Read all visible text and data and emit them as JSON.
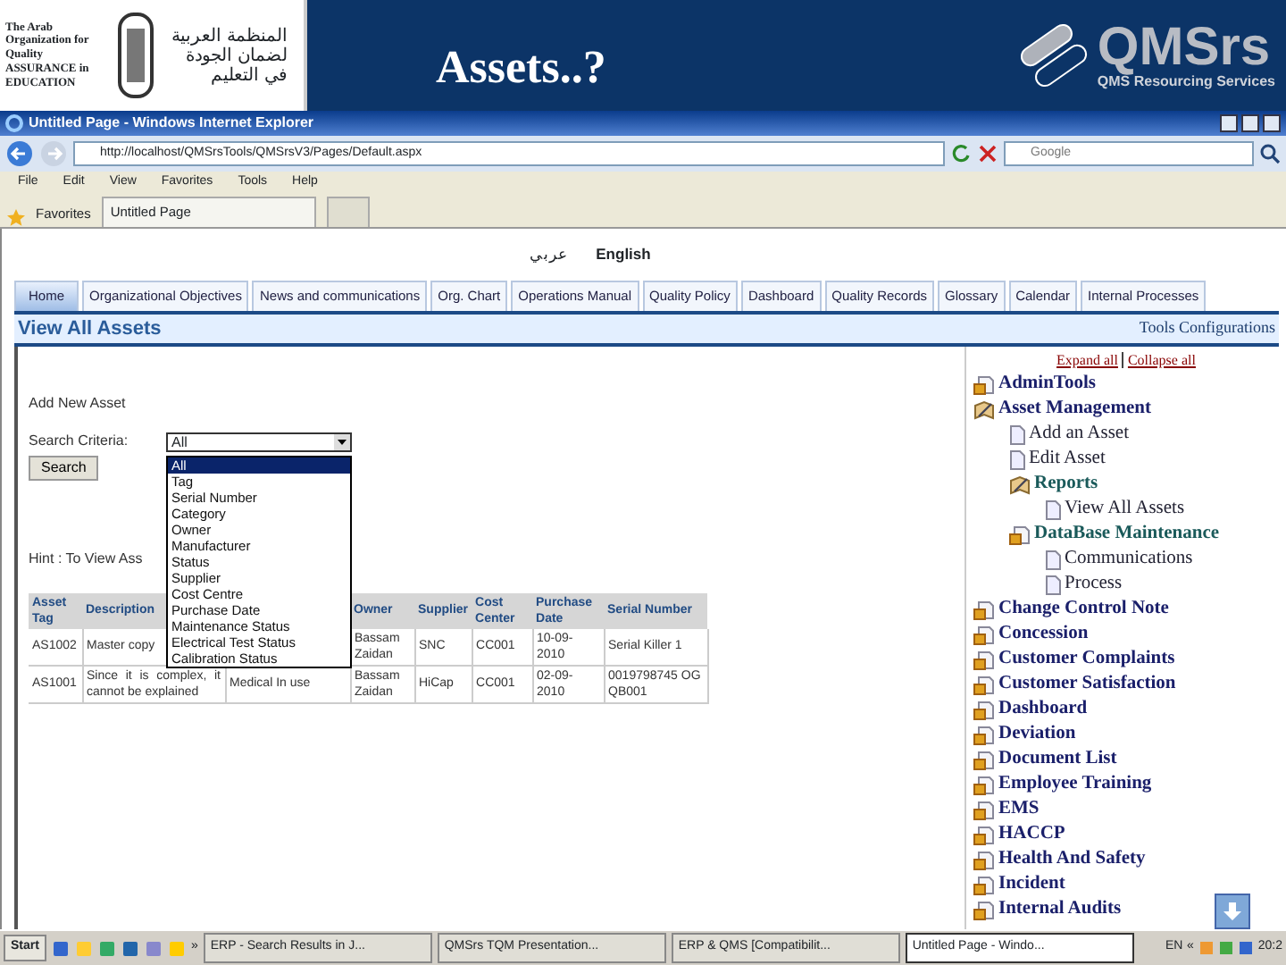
{
  "slide_header": {
    "org_logo_english": "The Arab Organization for Quality ASSURANCE in EDUCATION",
    "org_logo_arabic": "المنظمة العربية لضمان الجودة في التعليم",
    "title": "Assets..?",
    "brand": "QMSrs",
    "brand_tagline": "QMS Resourcing Services"
  },
  "window": {
    "title": "Untitled Page - Windows Internet Explorer",
    "address": "http://localhost/QMSrsTools/QMSrsV3/Pages/Default.aspx",
    "search_placeholder": "Google",
    "menu": [
      "File",
      "Edit",
      "View",
      "Favorites",
      "Tools",
      "Help"
    ],
    "favorites": "Favorites",
    "tab": "Untitled Page"
  },
  "languages": [
    {
      "label": "عربي",
      "selected": false
    },
    {
      "label": "English",
      "selected": true
    }
  ],
  "tabs": [
    {
      "label": "Home",
      "selected": true
    },
    {
      "label": "Organizational Objectives",
      "selected": false
    },
    {
      "label": "News and communications",
      "selected": false
    },
    {
      "label": "Org. Chart",
      "selected": false
    },
    {
      "label": "Operations Manual",
      "selected": false
    },
    {
      "label": "Quality Policy",
      "selected": false
    },
    {
      "label": "Dashboard",
      "selected": false
    },
    {
      "label": "Quality Records",
      "selected": false
    },
    {
      "label": "Glossary",
      "selected": false
    },
    {
      "label": "Calendar",
      "selected": false
    },
    {
      "label": "Internal Processes",
      "selected": false
    }
  ],
  "section": {
    "title": "View All Assets",
    "link": "Tools Configurations"
  },
  "add_link": "Add New Asset",
  "search": {
    "label": "Search Criteria:",
    "value": "All",
    "button": "Search",
    "options": [
      {
        "label": "All",
        "selected": true
      },
      {
        "label": "Tag",
        "selected": false
      },
      {
        "label": "Serial Number",
        "selected": false
      },
      {
        "label": "Category",
        "selected": false
      },
      {
        "label": "Owner",
        "selected": false
      },
      {
        "label": "Manufacturer",
        "selected": false
      },
      {
        "label": "Status",
        "selected": false
      },
      {
        "label": "Supplier",
        "selected": false
      },
      {
        "label": "Cost Centre",
        "selected": false
      },
      {
        "label": "Purchase Date",
        "selected": false
      },
      {
        "label": "Maintenance Status",
        "selected": false
      },
      {
        "label": "Electrical Test Status",
        "selected": false
      },
      {
        "label": "Calibration Status",
        "selected": false
      }
    ]
  },
  "hint": "Hint : To View Ass",
  "table": {
    "columns": [
      "Asset Tag",
      "Description",
      null,
      "Owner",
      "Supplier",
      "Cost Center",
      "Purchase Date",
      "Serial Number"
    ],
    "rows": [
      [
        "AS1002",
        "Master copy",
        null,
        "Bassam Zaidan",
        "SNC",
        "CC001",
        "10-09-2010",
        "Serial Killer 1"
      ],
      [
        "AS1001",
        "Since it is complex, it cannot be explained",
        "Medical In use",
        "Bassam Zaidan",
        "HiCap",
        "CC001",
        "02-09-2010",
        "0019798745 OG QB001"
      ]
    ]
  },
  "tree": {
    "expand_all": "Expand all",
    "collapse_all": "Collapse all",
    "items": [
      {
        "label": "AdminTools",
        "kind": "folder",
        "expanded": false
      },
      {
        "label": "Asset Management",
        "kind": "folder",
        "expanded": true,
        "children": [
          {
            "label": "Add an Asset",
            "kind": "page"
          },
          {
            "label": "Edit Asset",
            "kind": "page"
          },
          {
            "label": "Reports",
            "kind": "folder",
            "expanded": true,
            "children": [
              {
                "label": "View All Assets",
                "kind": "page"
              }
            ]
          },
          {
            "label": "DataBase Maintenance",
            "kind": "folder",
            "expanded": false,
            "children": [
              {
                "label": "Communications",
                "kind": "page"
              },
              {
                "label": "Process",
                "kind": "page"
              }
            ]
          }
        ]
      },
      {
        "label": "Change Control Note",
        "kind": "folder",
        "expanded": false
      },
      {
        "label": "Concession",
        "kind": "folder",
        "expanded": false
      },
      {
        "label": "Customer Complaints",
        "kind": "folder",
        "expanded": false
      },
      {
        "label": "Customer Satisfaction",
        "kind": "folder",
        "expanded": false
      },
      {
        "label": "Dashboard",
        "kind": "folder",
        "expanded": false
      },
      {
        "label": "Deviation",
        "kind": "folder",
        "expanded": false
      },
      {
        "label": "Document List",
        "kind": "folder",
        "expanded": false
      },
      {
        "label": "Employee Training",
        "kind": "folder",
        "expanded": false
      },
      {
        "label": "EMS",
        "kind": "folder",
        "expanded": false
      },
      {
        "label": "HACCP",
        "kind": "folder",
        "expanded": false
      },
      {
        "label": "Health And Safety",
        "kind": "folder",
        "expanded": false
      },
      {
        "label": "Incident",
        "kind": "folder",
        "expanded": false
      },
      {
        "label": "Internal Audits",
        "kind": "folder",
        "expanded": false
      }
    ]
  },
  "taskbar": {
    "start": "Start",
    "more": "»",
    "tasks": [
      {
        "label": "ERP - Search Results in J...",
        "selected": false
      },
      {
        "label": "QMSrs TQM Presentation...",
        "selected": false
      },
      {
        "label": "ERP & QMS [Compatibilit...",
        "selected": false
      },
      {
        "label": "Untitled Page - Windo...",
        "selected": true
      }
    ],
    "language": "EN",
    "tray_more": "«",
    "clock": "20:2"
  }
}
